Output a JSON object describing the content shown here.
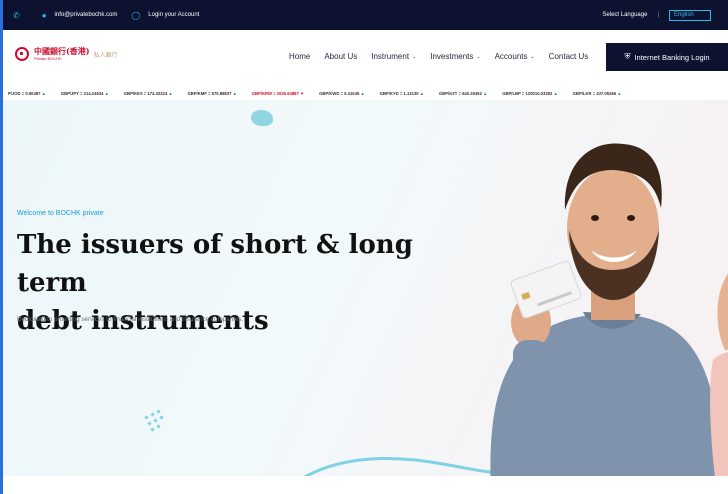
{
  "topbar": {
    "email": "info@privatebochk.com",
    "login": "Login your Account",
    "select_language": "Select Language",
    "language_value": "English"
  },
  "brand": {
    "logo_text": "中國銀行(香港)",
    "logo_sub": "Private BOCHK",
    "logo_tag": "私人銀行"
  },
  "nav": {
    "home": "Home",
    "about": "About Us",
    "instrument": "Instrument",
    "investments": "Investments",
    "accounts": "Accounts",
    "contact": "Contact Us",
    "internet_banking": "Internet Banking Login"
  },
  "ticker": [
    {
      "text": "P/JOD = 0.90487",
      "dir": "up"
    },
    {
      "text": "GBP/JPY = 214.24634",
      "dir": "up"
    },
    {
      "text": "GBP/KES = 174.32224",
      "dir": "up"
    },
    {
      "text": "GBP/KMF = 570.88837",
      "dir": "up"
    },
    {
      "text": "GBP/KRW = 2026.94887",
      "dir": "down"
    },
    {
      "text": "GBP/KWD = 0.41045",
      "dir": "up"
    },
    {
      "text": "GBP/KYD = 1.13130",
      "dir": "up"
    },
    {
      "text": "GBP/KZT = 640.26362",
      "dir": "up"
    },
    {
      "text": "GBP/LBP = 120010.03292",
      "dir": "up"
    },
    {
      "text": "GBP/LKR = 437.05266",
      "dir": "up"
    }
  ],
  "hero": {
    "welcome": "Welcome to BOCHK private",
    "title_line1": "The issuers of short & long term",
    "title_line2": "debt instruments",
    "subtitle": "Dedicated to providing services to financial institutions and insurance companies."
  },
  "icons": {
    "phone": "phone-icon",
    "email": "email-icon",
    "login": "user-circle-icon",
    "shield": "shield-icon",
    "caret": "chevron-down-icon"
  },
  "colors": {
    "navy": "#0c1230",
    "accent": "#2fb9e8",
    "brand_red": "#c8102e",
    "welcome": "#1a9fd0"
  }
}
